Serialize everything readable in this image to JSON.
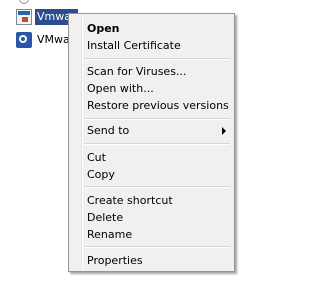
{
  "files": [
    {
      "label": "",
      "icon": "circle-icon",
      "selected": false
    },
    {
      "label": "Vmwar",
      "icon": "msi-package-icon",
      "selected": true
    },
    {
      "label": "VMwar",
      "icon": "application-icon",
      "selected": false
    }
  ],
  "context_menu": {
    "items": [
      {
        "label": "Open",
        "default": true
      },
      {
        "label": "Install Certificate"
      },
      {
        "label": "Scan for Viruses..."
      },
      {
        "label": "Open with..."
      },
      {
        "label": "Restore previous versions"
      },
      {
        "label": "Send to",
        "has_submenu": true
      },
      {
        "label": "Cut"
      },
      {
        "label": "Copy"
      },
      {
        "label": "Create shortcut"
      },
      {
        "label": "Delete"
      },
      {
        "label": "Rename"
      },
      {
        "label": "Properties"
      }
    ]
  },
  "colors": {
    "selection_background": "#2b4f8c",
    "menu_background": "#f0f0f0",
    "menu_border": "#979797"
  }
}
